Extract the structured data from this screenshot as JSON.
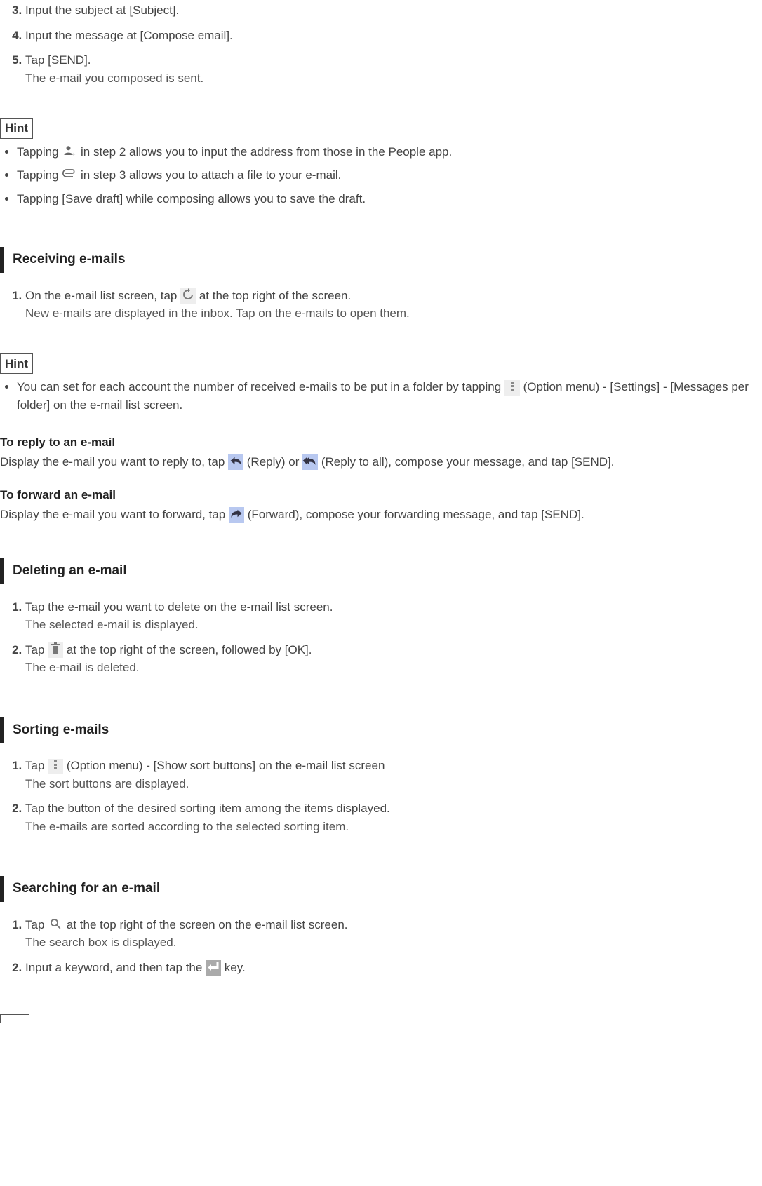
{
  "compose": {
    "step3": "Input the subject at [Subject].",
    "step4": "Input the message at [Compose email].",
    "step5": "Tap [SEND].",
    "step5_note": "The e-mail you composed is sent."
  },
  "hint1_label": "Hint",
  "hint1": {
    "a_pre": "Tapping ",
    "a_post": " in step 2 allows you to input the address from those in the People app.",
    "b_pre": "Tapping ",
    "b_post": " in step 3 allows you to attach a file to your e-mail.",
    "c": "Tapping [Save draft] while composing allows you to save the draft."
  },
  "receiving": {
    "title": "Receiving e-mails",
    "s1_pre": "On the e-mail list screen, tap ",
    "s1_post": " at the top right of the screen.",
    "s1_note": "New e-mails are displayed in the inbox. Tap on the e-mails to open them."
  },
  "hint2_label": "Hint",
  "hint2": {
    "pre": "You can set for each account the number of received e-mails to be put in a folder by tapping ",
    "post": " (Option menu) - [Settings] - [Messages per folder] on the e-mail list screen."
  },
  "reply": {
    "title": "To reply to an e-mail",
    "pre": "Display the e-mail you want to reply to, tap ",
    "mid1": " (Reply) or ",
    "mid2": " (Reply to all), compose your message, and tap [SEND]."
  },
  "forward": {
    "title": "To forward an e-mail",
    "pre": "Display the e-mail you want to forward, tap ",
    "post": " (Forward), compose your forwarding message, and tap [SEND]."
  },
  "deleting": {
    "title": "Deleting an e-mail",
    "s1": "Tap the e-mail you want to delete on the e-mail list screen.",
    "s1_note": "The selected e-mail is displayed.",
    "s2_pre": "Tap ",
    "s2_post": " at the top right of the screen, followed by [OK].",
    "s2_note": "The e-mail is deleted."
  },
  "sorting": {
    "title": "Sorting e-mails",
    "s1_pre": "Tap ",
    "s1_post": " (Option menu) - [Show sort buttons] on the e-mail list screen",
    "s1_note": "The sort buttons are displayed.",
    "s2": "Tap the button of the desired sorting item among the items displayed.",
    "s2_note": "The e-mails are sorted according to the selected sorting item."
  },
  "searching": {
    "title": "Searching for an e-mail",
    "s1_pre": "Tap ",
    "s1_post": " at the top right of the screen on the e-mail list screen.",
    "s1_note": "The search box is displayed.",
    "s2_pre": "Input a keyword, and then tap the ",
    "s2_post": " key."
  }
}
